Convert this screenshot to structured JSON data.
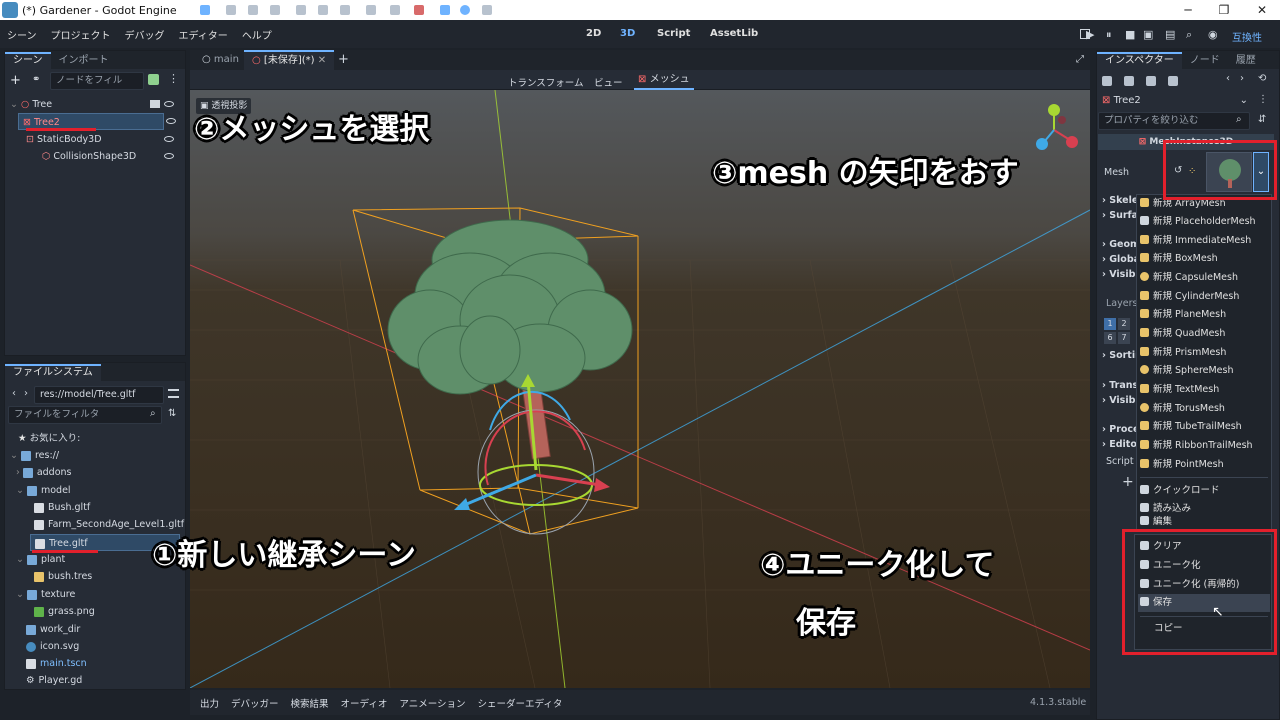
{
  "window": {
    "title": "(*) Gardener - Godot Engine"
  },
  "menubar": {
    "items": [
      "シーン",
      "プロジェクト",
      "デバッグ",
      "エディター",
      "ヘルプ"
    ],
    "modes": {
      "m2d": "2D",
      "m3d": "3D",
      "script": "Script",
      "assetlib": "AssetLib"
    },
    "renderer": "互換性"
  },
  "scene_panel": {
    "tabs": [
      "シーン",
      "インポート"
    ],
    "filter_placeholder": "ノードをフィル",
    "nodes": [
      "Tree",
      "Tree2",
      "StaticBody3D",
      "CollisionShape3D"
    ]
  },
  "filesystem": {
    "tab": "ファイルシステム",
    "path": "res://model/Tree.gltf",
    "filter_placeholder": "ファイルをフィルタ",
    "items": [
      "お気に入り:",
      "res://",
      "addons",
      "model",
      "Bush.gltf",
      "Farm_SecondAge_Level1.gltf",
      "Tree.gltf",
      "plant",
      "bush.tres",
      "texture",
      "grass.png",
      "work_dir",
      "icon.svg",
      "main.tscn",
      "Player.gd"
    ]
  },
  "editor_tabs": {
    "tab1": "main",
    "tab2": "[未保存](*)"
  },
  "toolbar3d": {
    "transform": "トランスフォーム",
    "view": "ビュー",
    "mesh": "メッシュ"
  },
  "viewport": {
    "label": "透視投影"
  },
  "bottom": {
    "tabs": [
      "出力",
      "デバッガー",
      "検索結果",
      "オーディオ",
      "アニメーション",
      "シェーダーエディタ"
    ],
    "version": "4.1.3.stable"
  },
  "inspector": {
    "tabs": [
      "インスペクター",
      "ノード",
      "履歴"
    ],
    "node": "Tree2",
    "filter_placeholder": "プロパティを絞り込む",
    "mesh_label": "Mesh",
    "section_header": "MeshInstance3D",
    "sections": [
      "Skelet",
      "Surfac",
      "Geom",
      "Globa",
      "Visibil",
      "Layers",
      "Sortin",
      "Transf",
      "Visibil",
      "Proce",
      "Editor",
      "Script"
    ],
    "layer_numbers": [
      "1",
      "2",
      "6",
      "7"
    ]
  },
  "mesh_menu": {
    "new_items": [
      "新規 ArrayMesh",
      "新規 PlaceholderMesh",
      "新規 ImmediateMesh",
      "新規 BoxMesh",
      "新規 CapsuleMesh",
      "新規 CylinderMesh",
      "新規 PlaneMesh",
      "新規 QuadMesh",
      "新規 PrismMesh",
      "新規 SphereMesh",
      "新規 TextMesh",
      "新規 TorusMesh",
      "新規 TubeTrailMesh",
      "新規 RibbonTrailMesh",
      "新規 PointMesh"
    ],
    "quickload": "クイックロード",
    "load": "読み込み",
    "edit": "編集",
    "clear": "クリア",
    "make_unique": "ユニーク化",
    "make_unique_recursive": "ユニーク化 (再帰的)",
    "save": "保存",
    "copy": "コピー"
  },
  "annotations": {
    "a1": "①新しい継承シーン",
    "a2": "②メッシュを選択",
    "a3": "③mesh の矢印をおす",
    "a4_line1": "④ユニーク化して",
    "a4_line2": "保存"
  },
  "colors": {
    "accent": "#6fb3ff",
    "annotation_red": "#e2202c",
    "tree_foliage": "#5f8f6a",
    "selection_box": "#f0a020"
  }
}
